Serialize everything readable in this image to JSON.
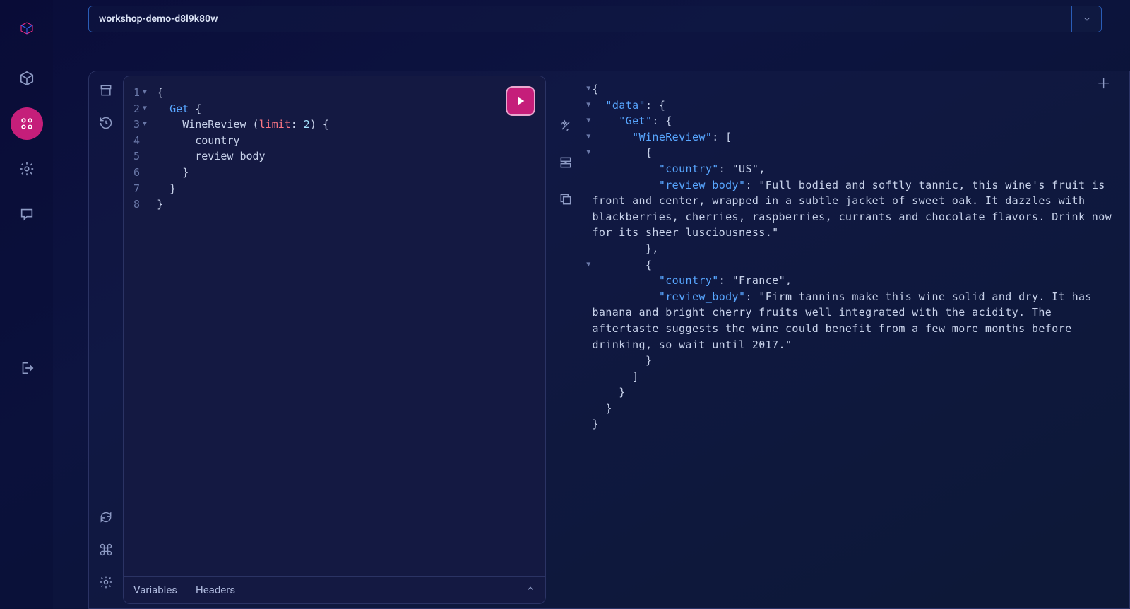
{
  "header": {
    "cluster_name": "workshop-demo-d8l9k80w"
  },
  "editor": {
    "lines": [
      "{",
      "  Get {",
      "    WineReview (limit: 2) {",
      "      country",
      "      review_body",
      "    }",
      "  }",
      "}"
    ]
  },
  "bottom_tabs": {
    "variables": "Variables",
    "headers": "Headers"
  },
  "result": {
    "data_key": "data",
    "get_key": "Get",
    "class_key": "WineReview",
    "rows": [
      {
        "country_key": "country",
        "country_val": "US",
        "review_key": "review_body",
        "review_val": "Full bodied and softly tannic, this wine's fruit is front and center, wrapped in a subtle jacket of sweet oak. It dazzles with blackberries, cherries, raspberries, currants and chocolate flavors. Drink now for its sheer lusciousness."
      },
      {
        "country_key": "country",
        "country_val": "France",
        "review_key": "review_body",
        "review_val": "Firm tannins make this wine solid and dry. It has banana and bright cherry fruits well integrated with the acidity. The aftertaste suggests the wine could benefit from a few more months before drinking, so wait until 2017."
      }
    ]
  }
}
